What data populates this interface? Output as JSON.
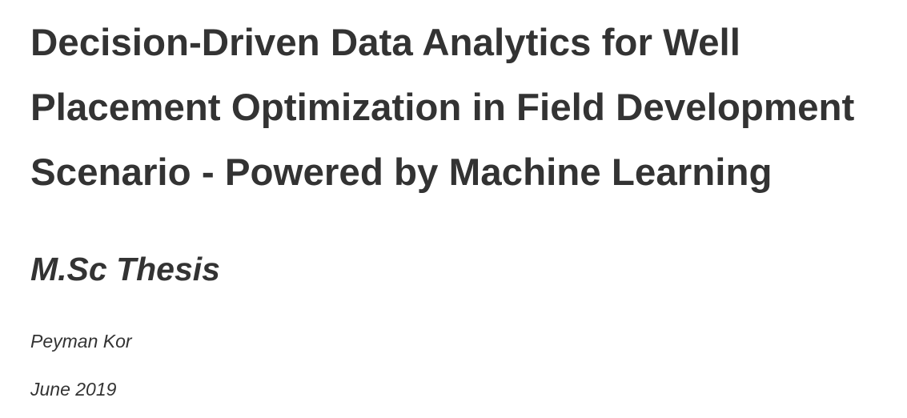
{
  "document": {
    "title_lines": [
      "Decision-Driven Data Analytics for Well",
      "Placement Optimization in Field Development",
      "Scenario - Powered by Machine Learning"
    ],
    "subtitle": "M.Sc Thesis",
    "author": "Peyman Kor",
    "date": "June 2019"
  },
  "colors": {
    "text": "#333333",
    "background": "#ffffff"
  }
}
